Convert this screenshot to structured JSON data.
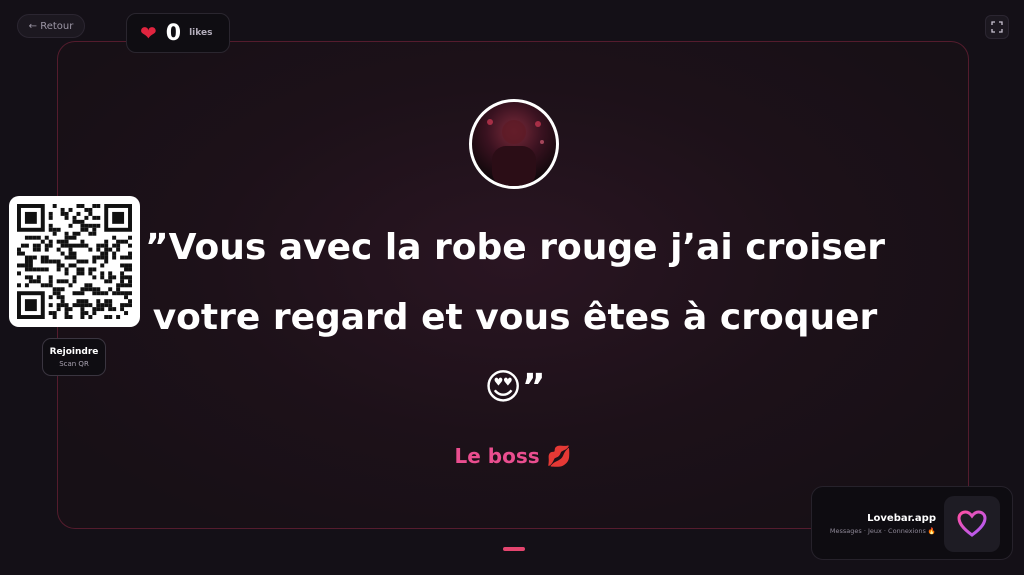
{
  "nav": {
    "back_label": "← Retour"
  },
  "likes": {
    "count": "0",
    "label": "likes",
    "icon": "heart-icon",
    "heart_color": "#e0243f"
  },
  "qr": {
    "title": "Rejoindre",
    "subtitle": "Scan QR"
  },
  "message": {
    "text": "”Vous avec la robe rouge j’ai croiser votre regard et vous êtes à croquer 😍”",
    "author": "Le boss 💋"
  },
  "brand": {
    "name": "Lovebar.app",
    "tagline": "Messages · Jeux · Connexions 🔥",
    "logo_icon": "heart-logo-icon"
  },
  "colors": {
    "accent": "#e4456f",
    "author": "#ea4e8f",
    "border": "#d7375f"
  }
}
